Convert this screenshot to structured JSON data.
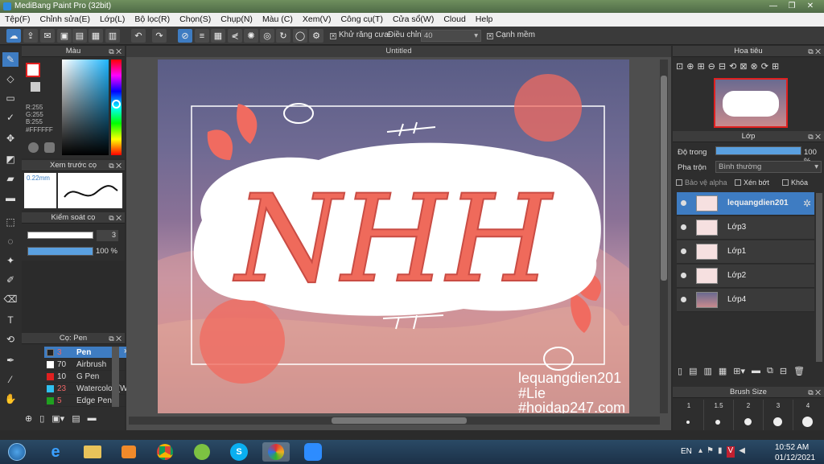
{
  "window": {
    "title": "MediBang Paint Pro (32bit)"
  },
  "menu": [
    "Tệp(F)",
    "Chỉnh sửa(E)",
    "Lớp(L)",
    "Bộ lọc(R)",
    "Chọn(S)",
    "Chụp(N)",
    "Màu (C)",
    "Xem(V)",
    "Công cụ(T)",
    "Cửa sổ(W)",
    "Cloud",
    "Help"
  ],
  "toolbar": {
    "antialias_label": "Khử răng cưa",
    "adjust_label": "Điều chỉnh",
    "adjust_value": "40",
    "soft_edge_label": "Cạnh mềm"
  },
  "color_panel": {
    "title": "Màu",
    "r": "R:255",
    "g": "G:255",
    "b": "B:255",
    "hex": "#FFFFFF"
  },
  "brush_preview": {
    "title": "Xem trước cọ",
    "size": "0.22mm"
  },
  "brush_control": {
    "title": "Kiểm soát cọ",
    "size": "3",
    "opacity": "100 %",
    "opacity_fraction": 1.0
  },
  "brush_list": {
    "title": "Cọ: Pen",
    "items": [
      {
        "size": "3",
        "name": "Pen",
        "color": "#222222",
        "selected": true
      },
      {
        "size": "70",
        "name": "Airbrush",
        "color": "#ffffff"
      },
      {
        "size": "10",
        "name": "G Pen",
        "color": "#e02020"
      },
      {
        "size": "23",
        "name": "Watercolor (Wet",
        "color": "#30c0f0"
      },
      {
        "size": "5",
        "name": "Edge Pen",
        "color": "#20a020"
      }
    ]
  },
  "document": {
    "tab": "Untitled"
  },
  "artwork": {
    "main_text": "NHH",
    "line1": "lequangdien201",
    "line2": "#Lie",
    "line3": "#hoidap247.com"
  },
  "navigator": {
    "title": "Hoa tiêu"
  },
  "layers_panel": {
    "title": "Lớp",
    "opacity_label": "Độ trong",
    "opacity_value": "100 %",
    "opacity_fraction": 1.0,
    "blend_label": "Pha trộn",
    "blend_value": "Bình thường",
    "protect_alpha": "Bảo vệ alpha",
    "clip": "Xén bớt",
    "lock": "Khóa",
    "layers": [
      {
        "name": "lequangdien201",
        "selected": true
      },
      {
        "name": "Lớp3"
      },
      {
        "name": "Lớp1"
      },
      {
        "name": "Lớp2"
      },
      {
        "name": "Lớp4"
      }
    ]
  },
  "brush_size_panel": {
    "title": "Brush Size",
    "sizes": [
      "1",
      "1.5",
      "2",
      "3",
      "4"
    ]
  },
  "taskbar": {
    "lang": "EN",
    "time": "10:52 AM",
    "date": "01/12/2021"
  }
}
